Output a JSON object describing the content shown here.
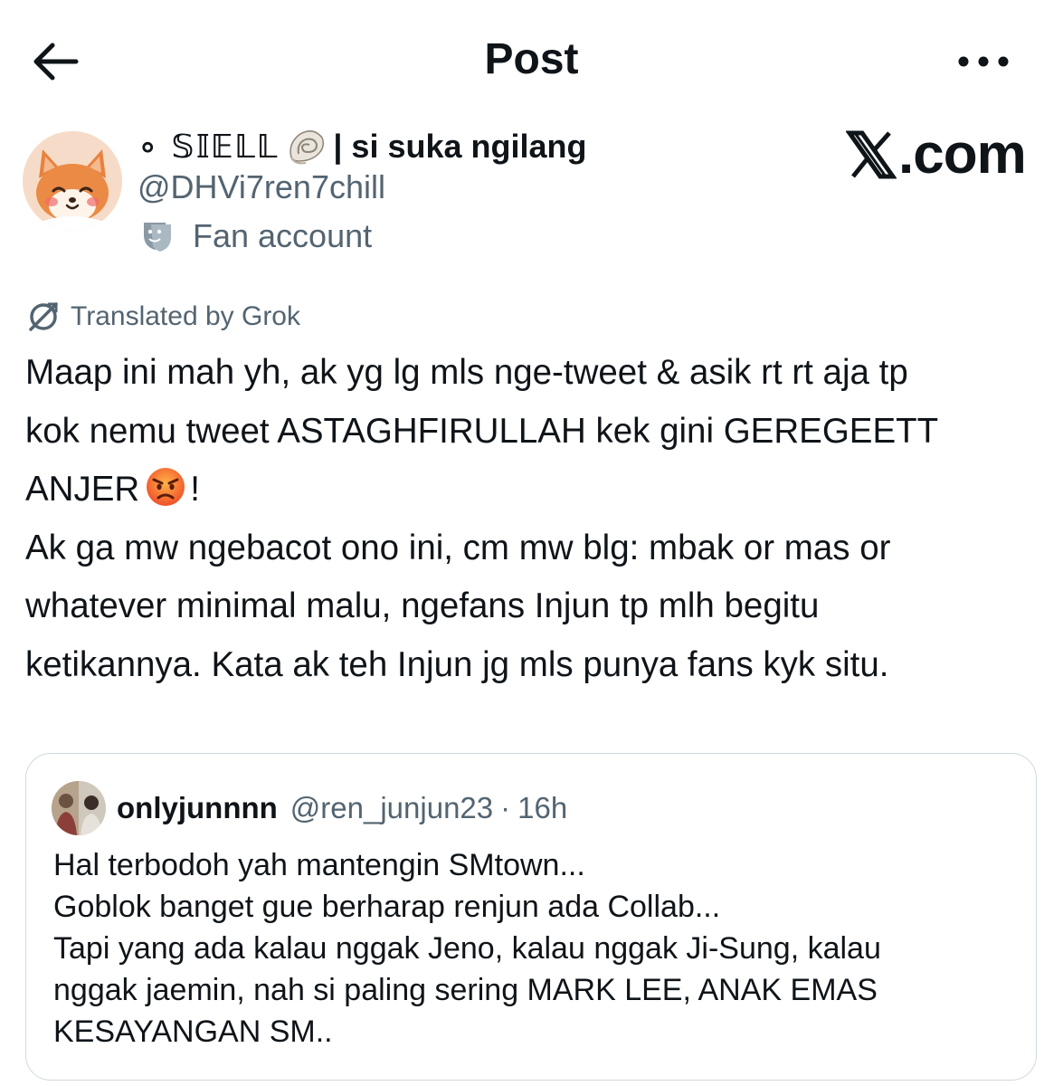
{
  "header": {
    "title": "Post"
  },
  "author": {
    "name_prefix": "∘ 𝕊𝕀𝔼𝕃𝕃",
    "name_suffix": "| si suka ngilang",
    "handle": "@DHVi7ren7chill",
    "label": "Fan account"
  },
  "watermark": {
    "site": ".com"
  },
  "translation": {
    "label": "Translated by Grok"
  },
  "tweet": {
    "line1": "Maap ini mah yh, ak yg lg mls nge-tweet & asik rt rt aja tp",
    "line2": "kok nemu tweet ASTAGHFIRULLAH kek gini GEREGEETT",
    "line3_before": "ANJER",
    "line3_after": "!",
    "line4": "Ak ga mw ngebacot ono ini, cm mw blg: mbak or mas or",
    "line5": "whatever minimal malu, ngefans Injun tp mlh begitu",
    "line6": "ketikannya. Kata ak teh Injun jg mls punya fans kyk situ."
  },
  "quoted_post": {
    "name": "onlyjunnnn",
    "handle": "@ren_junjun23",
    "separator": "·",
    "time": "16h",
    "lines": [
      "Hal terbodoh yah mantengin SMtown...",
      "Goblok banget gue berharap renjun ada Collab...",
      "Tapi yang ada kalau nggak Jeno, kalau nggak Ji-Sung, kalau",
      "nggak jaemin, nah si paling sering MARK LEE, ANAK EMAS",
      "KESAYANGAN SM.."
    ]
  },
  "icons": {
    "back": "arrow-left-icon",
    "more": "more-horizontal-icon",
    "shell": "spiral-shell-emoji",
    "label": "theater-mask-icon",
    "grok": "grok-icon",
    "angry": "angry-face-emoji"
  }
}
